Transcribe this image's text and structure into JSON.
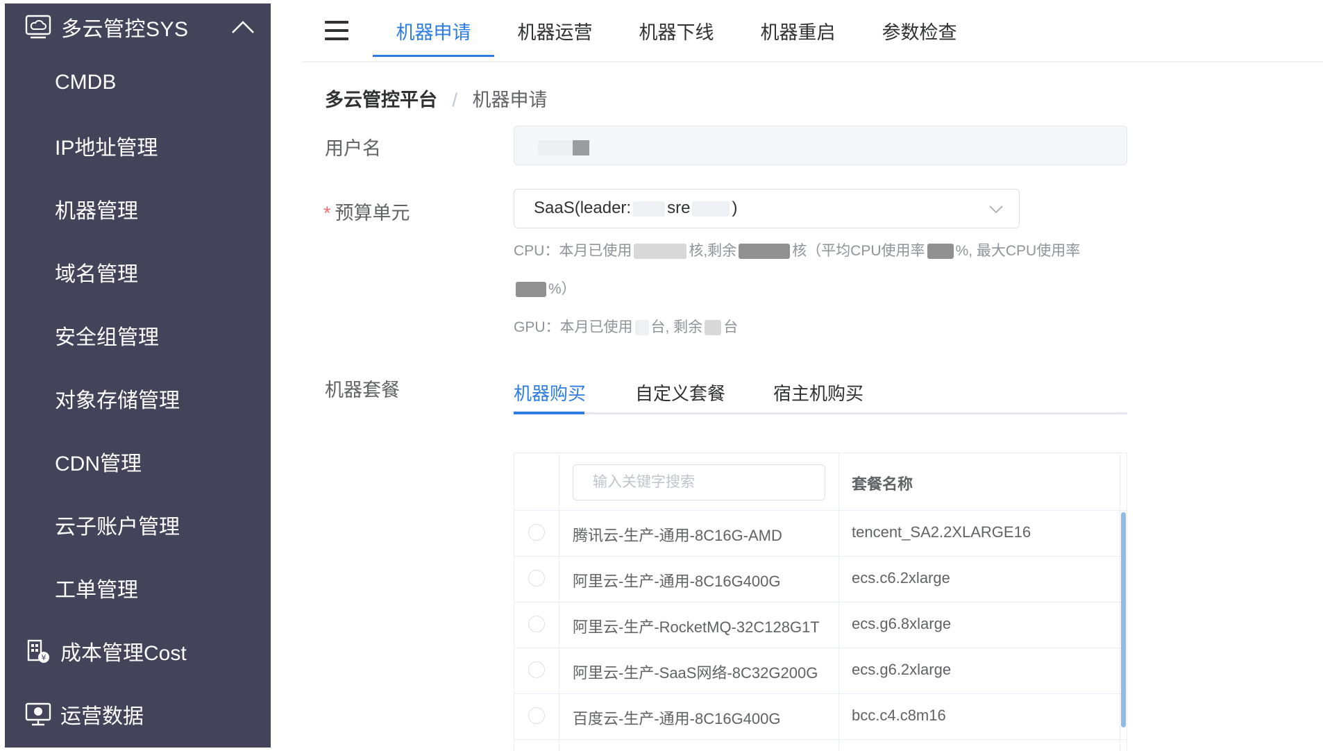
{
  "sidebar": {
    "header_title": "多云管控SYS",
    "items": [
      {
        "label": "CMDB"
      },
      {
        "label": "IP地址管理"
      },
      {
        "label": "机器管理"
      },
      {
        "label": "域名管理"
      },
      {
        "label": "安全组管理"
      },
      {
        "label": "对象存储管理"
      },
      {
        "label": "CDN管理"
      },
      {
        "label": "云子账户管理"
      },
      {
        "label": "工单管理"
      }
    ],
    "groups": [
      {
        "label": "成本管理Cost",
        "icon": "cost-building-icon"
      },
      {
        "label": "运营数据",
        "icon": "monitor-icon"
      }
    ]
  },
  "topnav": {
    "tabs": [
      {
        "label": "机器申请",
        "active": true
      },
      {
        "label": "机器运营"
      },
      {
        "label": "机器下线"
      },
      {
        "label": "机器重启"
      },
      {
        "label": "参数检查"
      }
    ]
  },
  "breadcrumb": {
    "root": "多云管控平台",
    "separator": "/",
    "current": "机器申请"
  },
  "form": {
    "username_label": "用户名",
    "budget_label": "预算单元",
    "budget_value_a": "SaaS(leader:",
    "budget_value_b": "sre",
    "budget_value_c": ")",
    "cpu_hint_1": "CPU：本月已使用",
    "cpu_hint_2": "核,剩余",
    "cpu_hint_3": "核（平均CPU使用率",
    "cpu_hint_4": "%, 最大CPU使用率",
    "cpu_hint_5": "%）",
    "gpu_hint_1": "GPU：本月已使用",
    "gpu_hint_2": "台, 剩余",
    "gpu_hint_3": "台",
    "package_label": "机器套餐"
  },
  "package_tabs": [
    {
      "label": "机器购买",
      "active": true
    },
    {
      "label": "自定义套餐"
    },
    {
      "label": "宿主机购买"
    }
  ],
  "table": {
    "search_placeholder": "输入关键字搜索",
    "col_name_header": "套餐名称",
    "rows": [
      {
        "package": "腾讯云-生产-通用-8C16G-AMD",
        "name": "tencent_SA2.2XLARGE16"
      },
      {
        "package": "阿里云-生产-通用-8C16G400G",
        "name": "ecs.c6.2xlarge"
      },
      {
        "package": "阿里云-生产-RocketMQ-32C128G1T",
        "name": "ecs.g6.8xlarge"
      },
      {
        "package": "阿里云-生产-SaaS网络-8C32G200G",
        "name": "ecs.g6.2xlarge"
      },
      {
        "package": "百度云-生产-通用-8C16G400G",
        "name": "bcc.c4.c8m16"
      }
    ]
  },
  "colors": {
    "sidebar_bg": "#43435a",
    "accent": "#2d7ce3",
    "required": "#f56c6c"
  }
}
